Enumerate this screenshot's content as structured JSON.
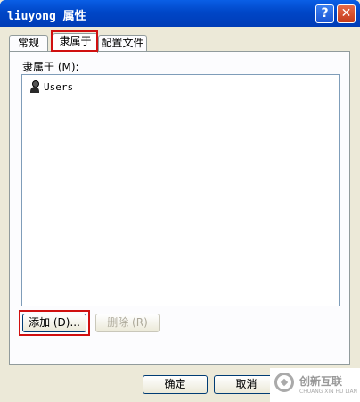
{
  "window": {
    "title": "liuyong 属性",
    "help_label": "?",
    "close_label": "✕"
  },
  "tabs": [
    {
      "label": "常规"
    },
    {
      "label": "隶属于"
    },
    {
      "label": "配置文件"
    }
  ],
  "member_of": {
    "label": "隶属于 (M):",
    "items": [
      {
        "name": "Users",
        "icon": "user-group-icon"
      }
    ]
  },
  "buttons": {
    "add": "添加 (D)...",
    "remove": "删除 (R)",
    "ok": "确定",
    "cancel": "取消"
  },
  "watermark": {
    "text": "创新互联",
    "sub": "CHUANG XIN HU LIAN"
  },
  "colors": {
    "title_bar": "#0046c7",
    "highlight_box": "#d01010"
  }
}
